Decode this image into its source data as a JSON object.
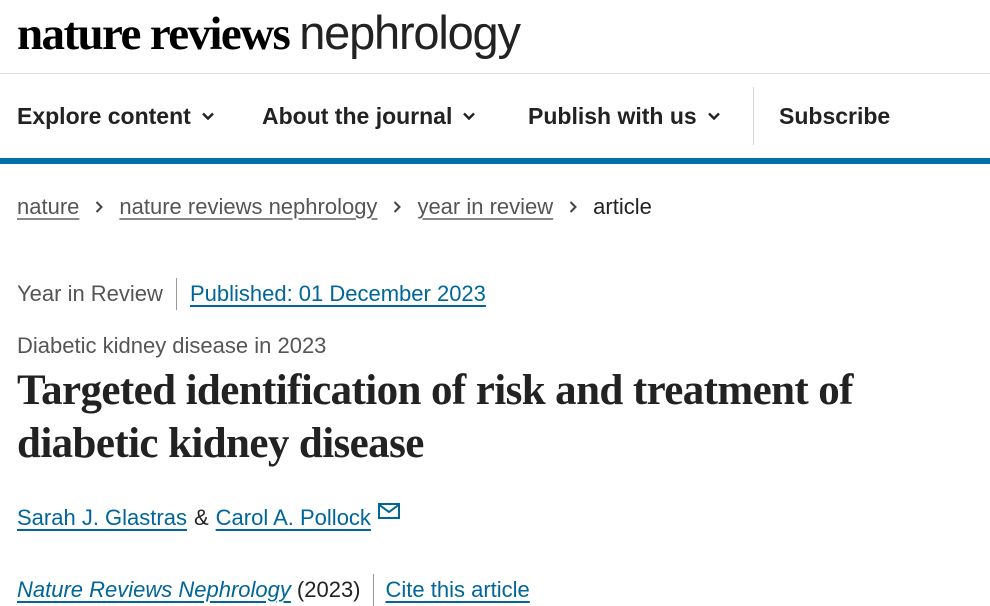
{
  "logo": {
    "bold": "nature reviews",
    "light": "nephrology"
  },
  "nav": {
    "explore": "Explore content",
    "about": "About the journal",
    "publish": "Publish with us",
    "subscribe": "Subscribe"
  },
  "breadcrumb": {
    "items": [
      "nature",
      "nature reviews nephrology",
      "year in review"
    ],
    "current": "article"
  },
  "meta": {
    "article_type": "Year in Review",
    "published": "Published: 01 December 2023"
  },
  "article": {
    "subtitle": "Diabetic kidney disease in 2023",
    "title": "Targeted identification of risk and treatment of diabetic kidney disease",
    "authors": [
      "Sarah J. Glastras",
      "Carol A. Pollock"
    ],
    "author_separator": "&"
  },
  "citation": {
    "journal": "Nature Reviews Nephrology",
    "year": "(2023)",
    "cite_link": "Cite this article"
  },
  "colors": {
    "accent": "#0070a8",
    "link": "#006699",
    "text": "#222222",
    "muted": "#555555"
  },
  "icons": {
    "nav_chevron": "chevron-down-icon",
    "breadcrumb_sep": "chevron-right-icon",
    "mail": "mail-icon"
  }
}
